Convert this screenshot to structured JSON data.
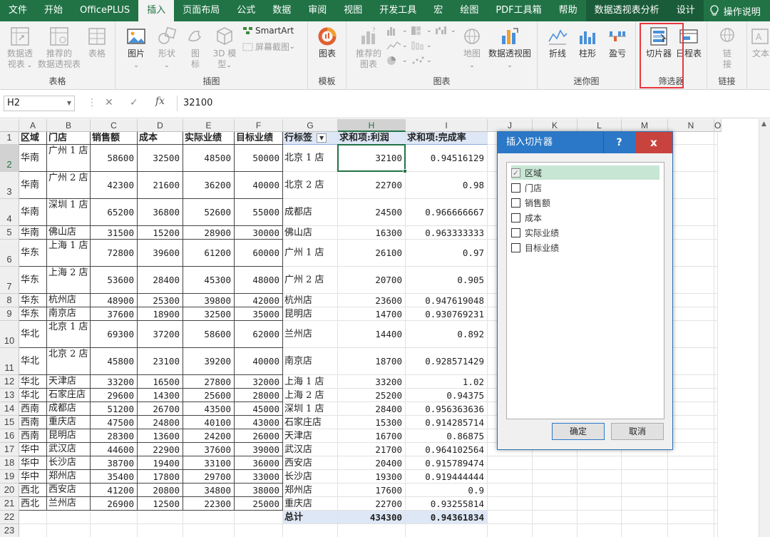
{
  "menu": {
    "tabs": [
      "文件",
      "开始",
      "OfficePLUS",
      "插入",
      "页面布局",
      "公式",
      "数据",
      "审阅",
      "视图",
      "开发工具",
      "宏",
      "绘图",
      "PDF工具箱",
      "帮助",
      "数据透视表分析",
      "设计"
    ],
    "active_index": 3,
    "tell_me": "操作说明"
  },
  "ribbon": {
    "groups": {
      "table": "表格",
      "illustrations": "插图",
      "templates": "模板",
      "charts": "图表",
      "sparklines": "迷你图",
      "filters": "筛选器",
      "links": "链接"
    },
    "buttons": {
      "recommended_pivot_l1": "数据透",
      "recommended_pivot_l2": "视表",
      "recommended_pivot2_l1": "推荐的",
      "recommended_pivot2_l2": "数据透视表",
      "table": "表格",
      "pictures": "图片",
      "shapes": "形状",
      "icons_l1": "图",
      "icons_l2": "标",
      "model3d_l1": "3D 模",
      "model3d_l2": "型",
      "smartart": "SmartArt",
      "screenshot": "屏幕截图",
      "template_chart": "图表",
      "recommended_charts_l1": "推荐的",
      "recommended_charts_l2": "图表",
      "maps": "地图",
      "pivotchart": "数据透视图",
      "spark_line": "折线",
      "spark_column": "柱形",
      "spark_winloss": "盈亏",
      "slicer": "切片器",
      "timeline": "日程表",
      "link_l1": "链",
      "link_l2": "接",
      "text": "文本"
    }
  },
  "formula_bar": {
    "name_box": "H2",
    "cancel_icon": "✕",
    "enter_icon": "✓",
    "fx": "fx",
    "value": "32100"
  },
  "columns": [
    "A",
    "B",
    "C",
    "D",
    "E",
    "F",
    "G",
    "H",
    "I",
    "J",
    "K",
    "L",
    "M",
    "N",
    "O"
  ],
  "selected_column": "H",
  "row_numbers": [
    "1",
    "2",
    "3",
    "4",
    "5",
    "6",
    "7",
    "8",
    "9",
    "10",
    "11",
    "12",
    "13",
    "14",
    "15",
    "16",
    "17",
    "18",
    "19",
    "20",
    "21",
    "22",
    "23"
  ],
  "selected_row": "2",
  "source_table": {
    "headers": [
      "区域",
      "门店",
      "销售额",
      "成本",
      "实际业绩",
      "目标业绩"
    ],
    "rows": [
      [
        "华南",
        "广州 1 店",
        "58600",
        "32500",
        "48500",
        "50000"
      ],
      [
        "华南",
        "广州 2 店",
        "42300",
        "21600",
        "36200",
        "40000"
      ],
      [
        "华南",
        "深圳 1 店",
        "65200",
        "36800",
        "52600",
        "55000"
      ],
      [
        "华南",
        "佛山店",
        "31500",
        "15200",
        "28900",
        "30000"
      ],
      [
        "华东",
        "上海 1 店",
        "72800",
        "39600",
        "61200",
        "60000"
      ],
      [
        "华东",
        "上海 2 店",
        "53600",
        "28400",
        "45300",
        "48000"
      ],
      [
        "华东",
        "杭州店",
        "48900",
        "25300",
        "39800",
        "42000"
      ],
      [
        "华东",
        "南京店",
        "37600",
        "18900",
        "32500",
        "35000"
      ],
      [
        "华北",
        "北京 1 店",
        "69300",
        "37200",
        "58600",
        "62000"
      ],
      [
        "华北",
        "北京 2 店",
        "45800",
        "23100",
        "39200",
        "40000"
      ],
      [
        "华北",
        "天津店",
        "33200",
        "16500",
        "27800",
        "32000"
      ],
      [
        "华北",
        "石家庄店",
        "29600",
        "14300",
        "25600",
        "28000"
      ],
      [
        "西南",
        "成都店",
        "51200",
        "26700",
        "43500",
        "45000"
      ],
      [
        "西南",
        "重庆店",
        "47500",
        "24800",
        "40100",
        "43000"
      ],
      [
        "西南",
        "昆明店",
        "28300",
        "13600",
        "24200",
        "26000"
      ],
      [
        "华中",
        "武汉店",
        "44600",
        "22900",
        "37600",
        "39000"
      ],
      [
        "华中",
        "长沙店",
        "38700",
        "19400",
        "33100",
        "36000"
      ],
      [
        "华中",
        "郑州店",
        "35400",
        "17800",
        "29700",
        "33000"
      ],
      [
        "西北",
        "西安店",
        "41200",
        "20800",
        "34800",
        "38000"
      ],
      [
        "西北",
        "兰州店",
        "26900",
        "12500",
        "22300",
        "25000"
      ]
    ]
  },
  "pivot": {
    "headers": [
      "行标签",
      "求和项:利润",
      "求和项:完成率"
    ],
    "rows": [
      [
        "北京 1 店",
        "32100",
        "0.94516129"
      ],
      [
        "北京 2 店",
        "22700",
        "0.98"
      ],
      [
        "成都店",
        "24500",
        "0.966666667"
      ],
      [
        "佛山店",
        "16300",
        "0.963333333"
      ],
      [
        "广州 1 店",
        "26100",
        "0.97"
      ],
      [
        "广州 2 店",
        "20700",
        "0.905"
      ],
      [
        "杭州店",
        "23600",
        "0.947619048"
      ],
      [
        "昆明店",
        "14700",
        "0.930769231"
      ],
      [
        "兰州店",
        "14400",
        "0.892"
      ],
      [
        "南京店",
        "18700",
        "0.928571429"
      ],
      [
        "上海 1 店",
        "33200",
        "1.02"
      ],
      [
        "上海 2 店",
        "25200",
        "0.94375"
      ],
      [
        "深圳 1 店",
        "28400",
        "0.956363636"
      ],
      [
        "石家庄店",
        "15300",
        "0.914285714"
      ],
      [
        "天津店",
        "16700",
        "0.86875"
      ],
      [
        "武汉店",
        "21700",
        "0.964102564"
      ],
      [
        "西安店",
        "20400",
        "0.915789474"
      ],
      [
        "长沙店",
        "19300",
        "0.919444444"
      ],
      [
        "郑州店",
        "17600",
        "0.9"
      ],
      [
        "重庆店",
        "22700",
        "0.93255814"
      ]
    ],
    "total": [
      "总计",
      "434300",
      "0.94361834"
    ]
  },
  "dialog": {
    "title": "插入切片器",
    "help": "?",
    "close": "x",
    "fields": [
      "区域",
      "门店",
      "销售额",
      "成本",
      "实际业绩",
      "目标业绩"
    ],
    "checked": [
      true,
      false,
      false,
      false,
      false,
      false
    ],
    "ok": "确定",
    "cancel": "取消"
  },
  "colors": {
    "excel_green": "#217346",
    "pivot_header_bg": "#dde7f5",
    "dialog_title_bg": "#2b78c8",
    "close_button_bg": "#c9433e",
    "highlight_red": "#e8383d"
  }
}
